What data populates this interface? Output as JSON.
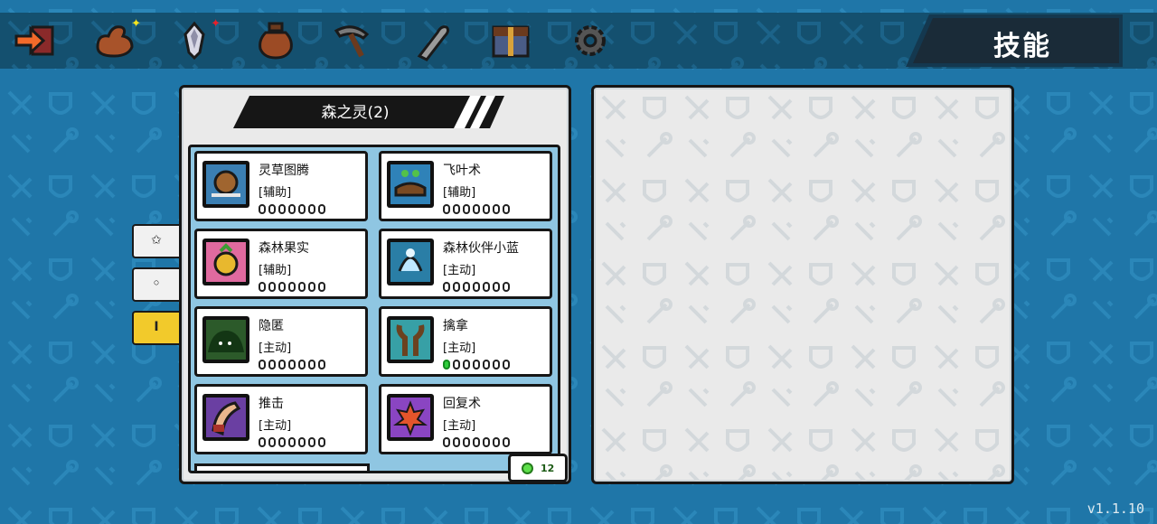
{
  "topbar": {
    "title": "技能",
    "icons": [
      {
        "name": "exit-arrow-icon"
      },
      {
        "name": "muscle-arm-icon",
        "badge": "✦",
        "badge_color": "#f7e51c"
      },
      {
        "name": "crystal-gem-icon",
        "badge": "✦",
        "badge_color": "#e8202a"
      },
      {
        "name": "potion-jar-icon"
      },
      {
        "name": "pickaxe-icon"
      },
      {
        "name": "bone-weapon-icon"
      },
      {
        "name": "treasure-chest-icon"
      },
      {
        "name": "settings-gear-icon"
      }
    ]
  },
  "side_tabs": [
    {
      "label": "✩",
      "active": false
    },
    {
      "label": "◦",
      "active": false
    },
    {
      "label": "I",
      "active": true
    }
  ],
  "skill_panel": {
    "header": "森之灵(2)",
    "skills": [
      {
        "name": "灵草图腾",
        "type": "[辅助]",
        "level": 0,
        "max_level": 7,
        "icon": "snail-totem-icon"
      },
      {
        "name": "飞叶术",
        "type": "[辅助]",
        "level": 0,
        "max_level": 7,
        "icon": "leaf-hands-icon"
      },
      {
        "name": "森林果实",
        "type": "[辅助]",
        "level": 0,
        "max_level": 7,
        "icon": "forest-fruit-icon"
      },
      {
        "name": "森林伙伴小蓝",
        "type": "[主动]",
        "level": 0,
        "max_level": 7,
        "icon": "blue-spirit-icon"
      },
      {
        "name": "隐匿",
        "type": "[主动]",
        "level": 0,
        "max_level": 7,
        "icon": "bush-stealth-icon"
      },
      {
        "name": "擒拿",
        "type": "[主动]",
        "level": 1,
        "max_level": 7,
        "icon": "tree-grab-icon"
      },
      {
        "name": "推击",
        "type": "[主动]",
        "level": 0,
        "max_level": 7,
        "icon": "push-strike-icon"
      },
      {
        "name": "回复术",
        "type": "[主动]",
        "level": 0,
        "max_level": 7,
        "icon": "maple-heal-icon"
      }
    ],
    "gem_count": "12"
  },
  "version": "v1.1.10",
  "colors": {
    "background": "#1f76a8",
    "topbar": "#14506f",
    "active_tab": "#f2ca2b",
    "level_pip_on": "#2fcf3c"
  }
}
